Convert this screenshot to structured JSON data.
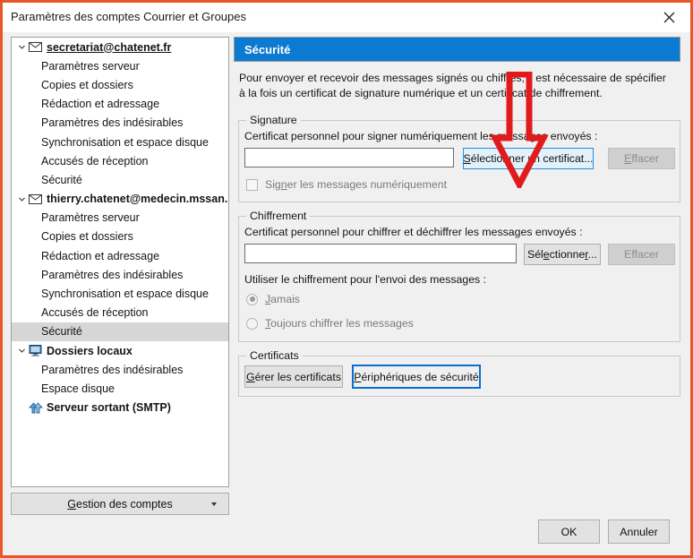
{
  "window": {
    "title": "Paramètres des comptes Courrier et Groupes",
    "close_icon": "close-icon",
    "border_color": "#e8562a"
  },
  "sidebar": {
    "rows": [
      {
        "label": "secretariat@chatenet.fr",
        "type": "account",
        "icon": "envelope-icon",
        "expanded": true,
        "hover": true,
        "selected": false
      },
      {
        "label": "Paramètres serveur",
        "type": "child",
        "selected": false
      },
      {
        "label": "Copies et dossiers",
        "type": "child",
        "selected": false
      },
      {
        "label": "Rédaction et adressage",
        "type": "child",
        "selected": false
      },
      {
        "label": "Paramètres des indésirables",
        "type": "child",
        "selected": false
      },
      {
        "label": "Synchronisation et espace disque",
        "type": "child",
        "selected": false
      },
      {
        "label": "Accusés de réception",
        "type": "child",
        "selected": false
      },
      {
        "label": "Sécurité",
        "type": "child",
        "selected": false
      },
      {
        "label": "thierry.chatenet@medecin.mssan...",
        "type": "account",
        "icon": "envelope-icon",
        "expanded": true,
        "hover": false,
        "selected": false
      },
      {
        "label": "Paramètres serveur",
        "type": "child",
        "selected": false
      },
      {
        "label": "Copies et dossiers",
        "type": "child",
        "selected": false
      },
      {
        "label": "Rédaction et adressage",
        "type": "child",
        "selected": false
      },
      {
        "label": "Paramètres des indésirables",
        "type": "child",
        "selected": false
      },
      {
        "label": "Synchronisation et espace disque",
        "type": "child",
        "selected": false
      },
      {
        "label": "Accusés de réception",
        "type": "child",
        "selected": false
      },
      {
        "label": "Sécurité",
        "type": "child",
        "selected": true
      },
      {
        "label": "Dossiers locaux",
        "type": "account",
        "icon": "monitor-icon",
        "expanded": true,
        "hover": false,
        "selected": false
      },
      {
        "label": "Paramètres des indésirables",
        "type": "child",
        "selected": false
      },
      {
        "label": "Espace disque",
        "type": "child",
        "selected": false
      },
      {
        "label": "Serveur sortant (SMTP)",
        "type": "account",
        "icon": "smtp-icon",
        "expanded": false,
        "hover": false,
        "selected": false
      }
    ],
    "accounts_button": {
      "label": "Gestion des comptes",
      "accesskey": "G",
      "dropdown_icon": "chevron-down-icon"
    }
  },
  "main": {
    "header": {
      "title": "Sécurité",
      "background": "#0b7ad1"
    },
    "intro": "Pour envoyer et recevoir des messages signés ou chiffrés, il est nécessaire de spécifier à la fois un certificat de signature numérique et un certificat de chiffrement.",
    "signature": {
      "legend": "Signature",
      "field_label": "Certificat personnel pour signer numériquement les messages envoyés :",
      "cert_value": "",
      "select_button": "Sélectionner un certificat...",
      "clear_button": "Effacer",
      "checkbox_label": "Signer les messages numériquement",
      "checkbox_checked": false
    },
    "encryption": {
      "legend": "Chiffrement",
      "field_label": "Certificat personnel pour chiffrer et déchiffrer les messages envoyés :",
      "cert_value": "",
      "select_button": "Sélectionner...",
      "clear_button": "Effacer",
      "usage_label": "Utiliser le chiffrement pour l'envoi des messages :",
      "options": [
        {
          "label": "Jamais",
          "checked": true
        },
        {
          "label": "Toujours chiffrer les messages",
          "checked": false
        }
      ]
    },
    "certificates": {
      "legend": "Certificats",
      "manage_button": "Gérer les certificats",
      "devices_button": "Périphériques de sécurité"
    }
  },
  "footer": {
    "ok_label": "OK",
    "cancel_label": "Annuler"
  },
  "annotations": {
    "arrow": {
      "color": "#e11b1b",
      "points_to": "Sélectionner un certificat..."
    },
    "highlight_box": {
      "color": "#0a6fd0",
      "target": "Périphériques de sécurité"
    }
  }
}
